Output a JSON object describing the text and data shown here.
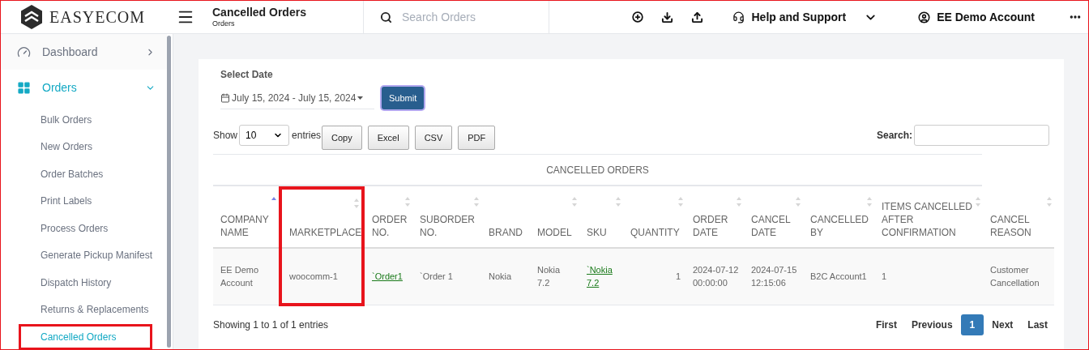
{
  "brand": {
    "name": "EASYECOM"
  },
  "header": {
    "title": "Cancelled Orders",
    "subtitle": "Orders",
    "search": {
      "placeholder": "Search Orders"
    },
    "help": "Help and Support",
    "account": "EE Demo Account"
  },
  "sidebar": {
    "items": [
      {
        "label": "Dashboard",
        "expanded": false,
        "selected": false
      },
      {
        "label": "Orders",
        "expanded": true,
        "selected": true,
        "children": [
          {
            "label": "Bulk Orders",
            "selected": false,
            "highlighted": false
          },
          {
            "label": "New Orders",
            "selected": false,
            "highlighted": false
          },
          {
            "label": "Order Batches",
            "selected": false,
            "highlighted": false
          },
          {
            "label": "Print Labels",
            "selected": false,
            "highlighted": false
          },
          {
            "label": "Process Orders",
            "selected": false,
            "highlighted": false
          },
          {
            "label": "Generate Pickup Manifest",
            "selected": false,
            "highlighted": false
          },
          {
            "label": "Dispatch History",
            "selected": false,
            "highlighted": false
          },
          {
            "label": "Returns & Replacements",
            "selected": false,
            "highlighted": false
          },
          {
            "label": "Cancelled Orders",
            "selected": true,
            "highlighted": true
          }
        ]
      }
    ]
  },
  "filters": {
    "date_label": "Select Date",
    "date_range": "July 15, 2024 - July 15, 2024",
    "submit": "Submit"
  },
  "table_controls": {
    "show": "Show",
    "page_size": "10",
    "entries": "entries",
    "exports": [
      "Copy",
      "Excel",
      "CSV",
      "PDF"
    ],
    "search_label": "Search:"
  },
  "table": {
    "caption": "CANCELLED ORDERS",
    "columns": [
      {
        "label": "COMPANY NAME",
        "sortable": true,
        "sorted": true,
        "highlighted": false
      },
      {
        "label": "MARKETPLACE",
        "sortable": true,
        "sorted": false,
        "highlighted": true
      },
      {
        "label": "ORDER NO.",
        "sortable": true,
        "sorted": false,
        "highlighted": false
      },
      {
        "label": "SUBORDER NO.",
        "sortable": true,
        "sorted": false,
        "highlighted": false
      },
      {
        "label": "BRAND",
        "sortable": false,
        "highlighted": false
      },
      {
        "label": "MODEL",
        "sortable": true,
        "sorted": false,
        "highlighted": false
      },
      {
        "label": "SKU",
        "sortable": true,
        "sorted": false,
        "highlighted": false
      },
      {
        "label": "QUANTITY",
        "sortable": true,
        "sorted": false,
        "highlighted": false
      },
      {
        "label": "ORDER DATE",
        "sortable": true,
        "sorted": false,
        "highlighted": false
      },
      {
        "label": "CANCEL DATE",
        "sortable": true,
        "sorted": false,
        "highlighted": false
      },
      {
        "label": "CANCELLED BY",
        "sortable": true,
        "sorted": false,
        "highlighted": false
      },
      {
        "label": "ITEMS CANCELLED AFTER CONFIRMATION",
        "sortable": true,
        "sorted": false,
        "highlighted": false
      },
      {
        "label": "CANCEL REASON",
        "sortable": true,
        "sorted": false,
        "highlighted": false
      }
    ],
    "rows": [
      {
        "cells": [
          {
            "kind": "text",
            "text": "EE Demo Account"
          },
          {
            "kind": "text",
            "text": "woocomm-1"
          },
          {
            "kind": "link",
            "text": "`Order1"
          },
          {
            "kind": "text",
            "text": "`Order 1"
          },
          {
            "kind": "text",
            "text": "Nokia"
          },
          {
            "kind": "text",
            "text": "Nokia 7.2"
          },
          {
            "kind": "link",
            "text": "`Nokia 7.2"
          },
          {
            "kind": "number",
            "text": "1"
          },
          {
            "kind": "text",
            "text": "2024-07-12 00:00:00"
          },
          {
            "kind": "text",
            "text": "2024-07-15 12:15:06"
          },
          {
            "kind": "text",
            "text": "B2C Account1"
          },
          {
            "kind": "text",
            "text": "1"
          },
          {
            "kind": "text",
            "text": "Customer Cancellation"
          }
        ]
      }
    ]
  },
  "footer": {
    "info": "Showing 1 to 1 of 1 entries",
    "pagination": [
      {
        "label": "First",
        "selected": false
      },
      {
        "label": "Previous",
        "selected": false
      },
      {
        "label": "1",
        "selected": true
      },
      {
        "label": "Next",
        "selected": false
      },
      {
        "label": "Last",
        "selected": false
      }
    ]
  }
}
